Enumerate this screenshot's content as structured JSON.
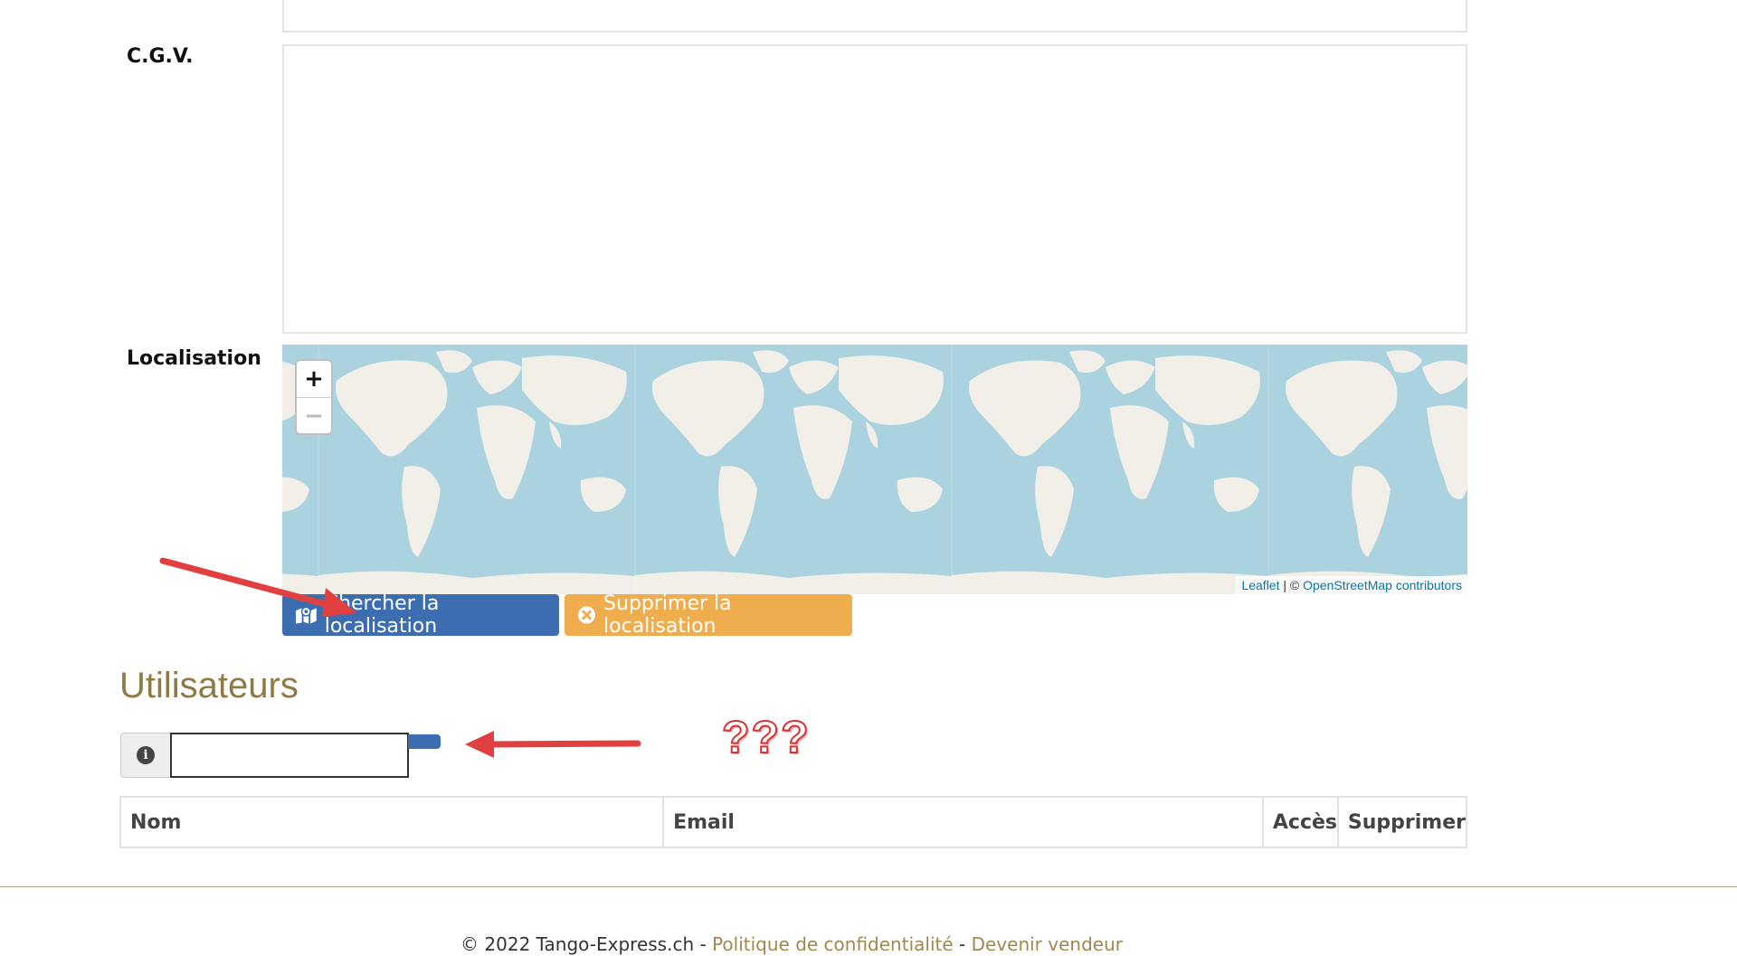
{
  "form": {
    "cgv_label": "C.G.V.",
    "localisation_label": "Localisation"
  },
  "map": {
    "zoom_in": "+",
    "zoom_out": "−",
    "attribution_leaflet": "Leaflet",
    "attribution_sep": " | © ",
    "attribution_osm": "OpenStreetMap contributors"
  },
  "buttons": {
    "search_location": "Chercher la localisation",
    "remove_location": "Supprimer la localisation"
  },
  "users": {
    "heading": "Utilisateurs",
    "info_icon": "i",
    "columns": [
      "Nom",
      "Email",
      "Accès",
      "Supprimer"
    ]
  },
  "annotation": {
    "question": "???"
  },
  "footer": {
    "copyright": "© 2022 Tango-Express.ch - ",
    "privacy_link": "Politique de confidentialité",
    "separator": " - ",
    "seller_link": "Devenir vendeur"
  },
  "colors": {
    "primary": "#3c6db0",
    "warning": "#f0ad4e",
    "heading": "#8e7a44",
    "annotation": "#e04040",
    "map_water": "#aad3df",
    "map_land": "#f2efe9"
  }
}
